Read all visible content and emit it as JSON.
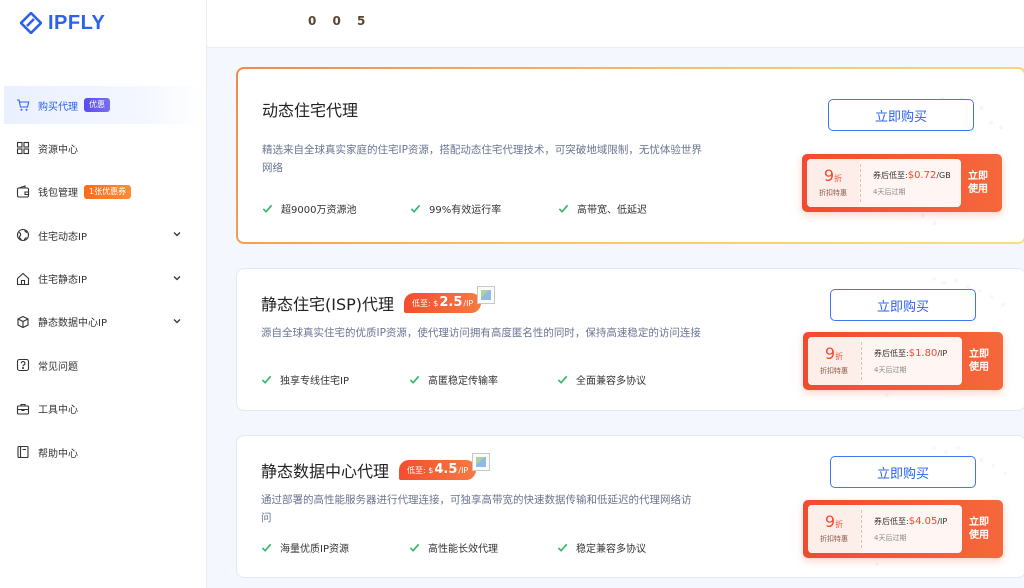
{
  "brand": {
    "name": "IPFLY",
    "color": "#2a62ef"
  },
  "header": {
    "text": "0 0 5"
  },
  "sidebar": {
    "items": [
      {
        "label": "购买代理",
        "icon": "cart-icon",
        "badge": "优惠",
        "active": true
      },
      {
        "label": "资源中心",
        "icon": "grid-icon"
      },
      {
        "label": "钱包管理",
        "icon": "wallet-icon",
        "badge": "1张优惠券"
      },
      {
        "label": "住宅动态IP",
        "icon": "globe-icon",
        "expandable": true
      },
      {
        "label": "住宅静态IP",
        "icon": "home-icon",
        "expandable": true
      },
      {
        "label": "静态数据中心IP",
        "icon": "cube-icon",
        "expandable": true
      },
      {
        "label": "常见问题",
        "icon": "question-icon"
      },
      {
        "label": "工具中心",
        "icon": "toolbox-icon"
      },
      {
        "label": "帮助中心",
        "icon": "book-icon"
      }
    ]
  },
  "products": [
    {
      "title": "动态住宅代理",
      "desc": "精选来自全球真实家庭的住宅IP资源，搭配动态住宅代理技术，可突破地域限制，无忧体验世界网络",
      "features": [
        "超9000万资源池",
        "99%有效运行率",
        "高带宽、低延迟"
      ],
      "buy_label": "立即购买",
      "coupon": {
        "discount": "9",
        "discount_unit": "折",
        "discount_label": "折扣特惠",
        "price_prefix": "券后低至:",
        "price": "$0.72",
        "price_unit": "/GB",
        "expire": "4天后过期",
        "use_label_1": "立即",
        "use_label_2": "使用"
      }
    },
    {
      "title": "静态住宅(ISP)代理",
      "price_tag": {
        "prefix": "低至: $",
        "num": "2.5",
        "unit": "/IP"
      },
      "desc": "源自全球真实住宅的优质IP资源，使代理访问拥有高度匿名性的同时，保持高速稳定的访问连接",
      "features": [
        "独享专线住宅IP",
        "高匿稳定传输率",
        "全面兼容多协议"
      ],
      "buy_label": "立即购买",
      "coupon": {
        "discount": "9",
        "discount_unit": "折",
        "discount_label": "折扣特惠",
        "price_prefix": "券后低至:",
        "price": "$1.80",
        "price_unit": "/IP",
        "expire": "4天后过期",
        "use_label_1": "立即",
        "use_label_2": "使用"
      }
    },
    {
      "title": "静态数据中心代理",
      "price_tag": {
        "prefix": "低至: $",
        "num": "4.5",
        "unit": "/IP"
      },
      "desc": "通过部署的高性能服务器进行代理连接，可独享高带宽的快速数据传输和低延迟的代理网络访问",
      "features": [
        "海量优质IP资源",
        "高性能长效代理",
        "稳定兼容多协议"
      ],
      "buy_label": "立即购买",
      "coupon": {
        "discount": "9",
        "discount_unit": "折",
        "discount_label": "折扣特惠",
        "price_prefix": "券后低至:",
        "price": "$4.05",
        "price_unit": "/IP",
        "expire": "4天后过期",
        "use_label_1": "立即",
        "use_label_2": "使用"
      }
    }
  ]
}
